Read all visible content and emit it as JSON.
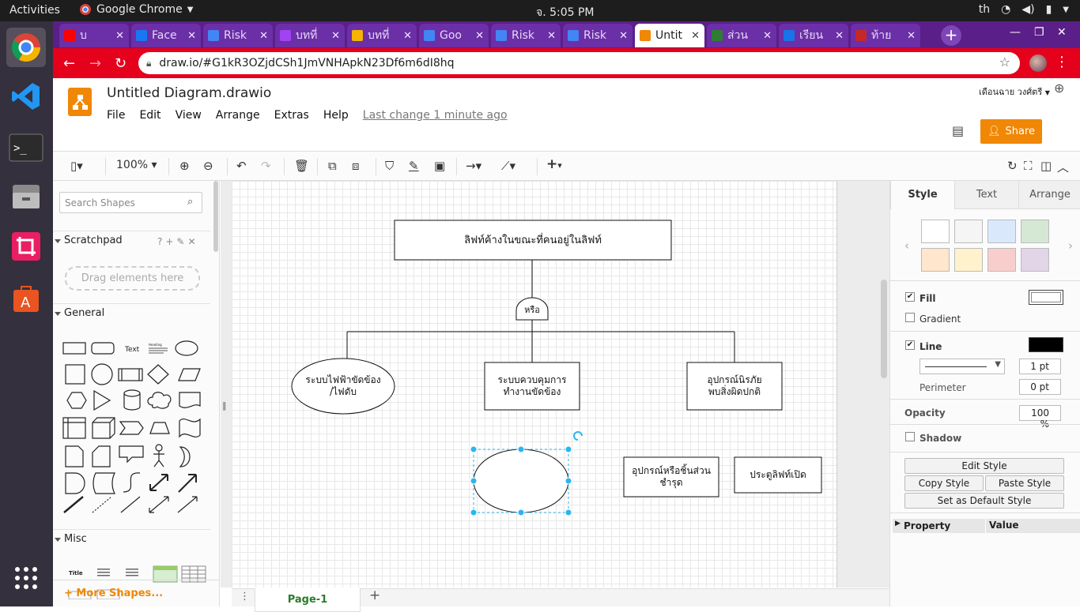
{
  "os": {
    "activities": "Activities",
    "app_name": "Google Chrome",
    "clock": "จ.  5:05 PM",
    "lang": "th"
  },
  "dock": [
    "chrome-icon",
    "vscode-icon",
    "terminal-icon",
    "files-icon",
    "screenshot-icon",
    "software-store-icon",
    "app-grid-icon"
  ],
  "tabs": [
    {
      "label": "บ",
      "color": "#ff0000"
    },
    {
      "label": "Face",
      "color": "#1877f2"
    },
    {
      "label": "Risk",
      "color": "#4285f4"
    },
    {
      "label": "บทที่",
      "color": "#a142f4"
    },
    {
      "label": "บทที่",
      "color": "#f4b400"
    },
    {
      "label": "Goo",
      "color": "#4285f4"
    },
    {
      "label": "Risk",
      "color": "#4285f4"
    },
    {
      "label": "Risk",
      "color": "#4285f4"
    },
    {
      "label": "Untit",
      "color": "#f08705",
      "active": true
    },
    {
      "label": "ส่วน",
      "color": "#2e7d32"
    },
    {
      "label": "เรียน",
      "color": "#1a73e8"
    },
    {
      "label": "ท้าย",
      "color": "#c62828"
    }
  ],
  "address": {
    "url": "draw.io/#G1kR3OZjdCSh1JmVNHApkN23Df6m6dI8hq"
  },
  "drawio": {
    "title": "Untitled Diagram.drawio",
    "menus": [
      "File",
      "Edit",
      "View",
      "Arrange",
      "Extras",
      "Help"
    ],
    "last_change": "Last change 1 minute ago",
    "user": "เดือนฉาย วงศ์ตรี",
    "share": "Share",
    "zoom": "100%"
  },
  "sidebar": {
    "search_placeholder": "Search Shapes",
    "scratchpad": "Scratchpad",
    "scratch_actions": "?+✎✕",
    "drag_hint": "Drag elements here",
    "general": "General",
    "misc": "Misc",
    "shape_text": "Text",
    "shape_heading": "Heading",
    "more_shapes": "More Shapes..."
  },
  "diagram": {
    "top_event": "ลิฟท์ค้างในขณะที่คนอยู่ในลิฟท์",
    "gate": "หรือ",
    "node_power": "ระบบไฟฟ้าขัดข้อง\n/ไฟดับ",
    "node_control": "ระบบควบคุมการ\nทำงานขัดข้อง",
    "node_safety": "อุปกรณ์นิรภัย\nพบสิ่งผิดปกติ",
    "node_parts": "อุปกรณ์หรือชิ้นส่วน\nชำรุด",
    "node_door": "ประตูลิฟท์เปิด"
  },
  "page_tab": "Page-1",
  "format_panel": {
    "tabs": [
      "Style",
      "Text",
      "Arrange"
    ],
    "swatches": [
      "#ffffff",
      "#f5f5f5",
      "#dae8fc",
      "#d5e8d4",
      "#ffe6cc",
      "#fff2cc",
      "#f8cecc",
      "#e1d5e7"
    ],
    "fill": "Fill",
    "gradient": "Gradient",
    "line": "Line",
    "line_width": "1 pt",
    "perimeter": "Perimeter",
    "perimeter_value": "0 pt",
    "opacity": "Opacity",
    "opacity_value": "100 %",
    "shadow": "Shadow",
    "edit_style": "Edit Style",
    "copy_style": "Copy Style",
    "paste_style": "Paste Style",
    "set_default": "Set as Default Style",
    "property": "Property",
    "value": "Value"
  }
}
